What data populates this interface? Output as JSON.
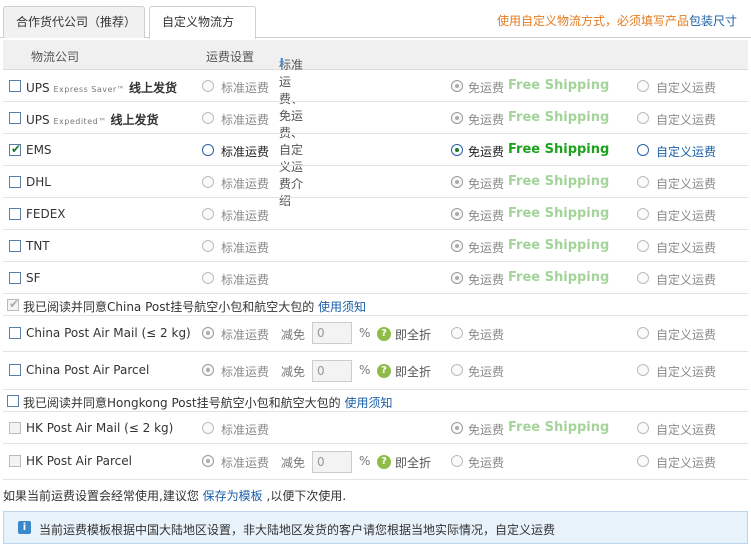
{
  "tabs": [
    {
      "label": "合作货代公司（推荐）"
    },
    {
      "label": "自定义物流方式"
    }
  ],
  "notice": {
    "text": "使用自定义物流方式，必须填写产品",
    "link": "包装尺寸"
  },
  "header": {
    "company": "物流公司",
    "setting": "运费设置",
    "intro": "标准运费、免运费、自定义运费介绍"
  },
  "options": {
    "standard": "标准运费",
    "free": "免运费",
    "free_en": "Free Shipping",
    "custom": "自定义运费",
    "minus": "减免",
    "pct": "%",
    "all": "即全折"
  },
  "carriers": [
    {
      "name": "UPS",
      "sub": "Express Saver™",
      "suffix": "线上发货",
      "checked": false,
      "selected": "free"
    },
    {
      "name": "UPS",
      "sub": "Expedited™",
      "suffix": "线上发货",
      "checked": false,
      "selected": "free"
    },
    {
      "name": "EMS",
      "sub": "",
      "suffix": "",
      "checked": true,
      "selected": "free"
    },
    {
      "name": "DHL",
      "sub": "",
      "suffix": "",
      "checked": false,
      "selected": "free"
    },
    {
      "name": "FEDEX",
      "sub": "",
      "suffix": "",
      "checked": false,
      "selected": "free"
    },
    {
      "name": "TNT",
      "sub": "",
      "suffix": "",
      "checked": false,
      "selected": "free"
    },
    {
      "name": "SF",
      "sub": "",
      "suffix": "",
      "checked": false,
      "selected": "free"
    }
  ],
  "china_post": {
    "agree_text": "我已阅读并同意China Post挂号航空小包和航空大包的",
    "agree_link": "使用须知",
    "agree_checked": true,
    "items": [
      {
        "name": "China Post Air Mail (≤ 2 kg)",
        "discount": "0"
      },
      {
        "name": "China Post Air Parcel",
        "discount": "0"
      }
    ]
  },
  "hk_post": {
    "agree_text": "我已阅读并同意Hongkong Post挂号航空小包和航空大包的",
    "agree_link": "使用须知",
    "agree_checked": false,
    "items": [
      {
        "name": "HK Post Air Mail (≤ 2 kg)",
        "discount": ""
      },
      {
        "name": "HK Post Air Parcel",
        "discount": "0"
      }
    ]
  },
  "footer": {
    "text_before": "如果当前运费设置会经常使用,建议您",
    "link": "保存为模板",
    "text_after": ",以便下次使用."
  },
  "info": {
    "icon": "i",
    "text": "当前运费模板根据中国大陆地区设置，非大陆地区发货的客户请您根据当地实际情况，自定义运费"
  }
}
